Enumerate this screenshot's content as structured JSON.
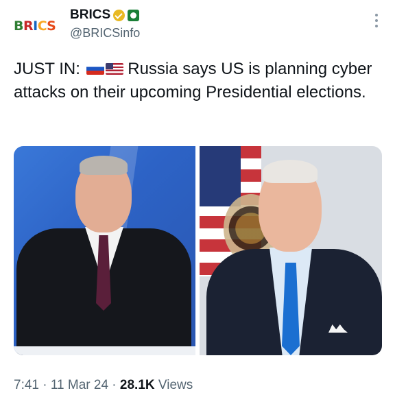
{
  "author": {
    "avatar_text": "BRICS",
    "display_name": "BRICS",
    "handle": "@BRICSinfo",
    "icons": [
      "gold-verified-badge-icon",
      "affiliate-badge-icon",
      "more-vertical-icon"
    ]
  },
  "tweet": {
    "prefix": "JUST IN:",
    "flags": [
      "russia-flag-icon",
      "us-flag-icon"
    ],
    "body": "Russia says US is planning cyber attacks on their upcoming Presidential elections."
  },
  "media": {
    "count": 2,
    "colors": {
      "left_bg": "#2d63c6",
      "right_bg": "#d9dde3"
    }
  },
  "meta": {
    "time": "7:41",
    "date": "11 Mar 24",
    "views_count": "28.1K",
    "views_label": "Views"
  },
  "colors": {
    "text": "#0f1419",
    "secondary": "#536471",
    "verified": "#e8b923"
  }
}
